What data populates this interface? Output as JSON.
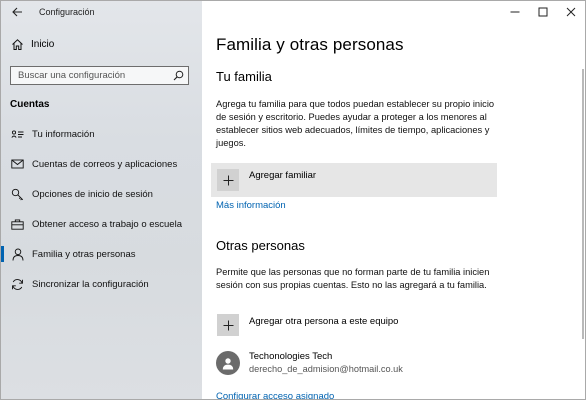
{
  "window": {
    "title": "Configuración"
  },
  "sidebar": {
    "home_label": "Inicio",
    "search_placeholder": "Buscar una configuración",
    "section": "Cuentas",
    "items": [
      {
        "label": "Tu información",
        "icon": "person-card-icon"
      },
      {
        "label": "Cuentas de correos y aplicaciones",
        "icon": "mail-icon"
      },
      {
        "label": "Opciones de inicio de sesión",
        "icon": "key-icon"
      },
      {
        "label": "Obtener acceso a trabajo o escuela",
        "icon": "briefcase-icon"
      },
      {
        "label": "Familia y otras personas",
        "icon": "person-icon",
        "active": true
      },
      {
        "label": "Sincronizar la configuración",
        "icon": "sync-icon"
      }
    ]
  },
  "main": {
    "title": "Familia y otras personas",
    "family": {
      "heading": "Tu familia",
      "description": "Agrega tu familia para que todos puedan establecer su propio inicio de sesión y escritorio. Puedes ayudar a proteger a los menores al establecer sitios web adecuados, límites de tiempo, aplicaciones y juegos.",
      "add_label": "Agregar familiar",
      "more_info": "Más información"
    },
    "others": {
      "heading": "Otras personas",
      "description": "Permite que las personas que no forman parte de tu familia inicien sesión con sus propias cuentas. Esto no las agregará a tu familia.",
      "add_label": "Agregar otra persona a este equipo",
      "person": {
        "name": "Techonologies Tech",
        "email": "derecho_de_admision@hotmail.co.uk"
      },
      "assigned_access": "Configurar acceso asignado"
    }
  },
  "colors": {
    "accent": "#0063b1",
    "sidebar_bg": "#dcdfe3"
  }
}
